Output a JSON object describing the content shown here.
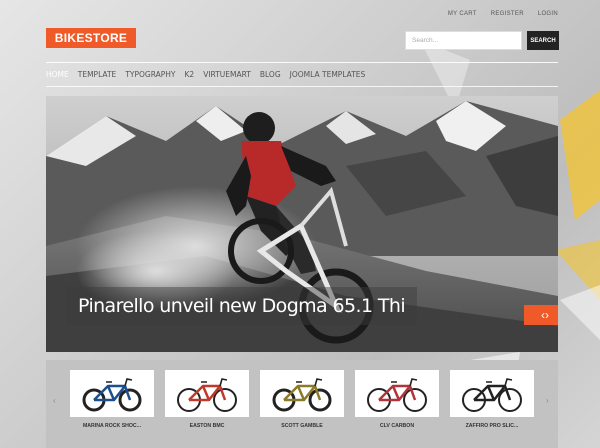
{
  "header": {
    "top_links": [
      "MY CART",
      "REGISTER",
      "LOGIN"
    ],
    "logo_text": "BIKESTORE",
    "search_placeholder": "Search...",
    "search_button": "SEARCH"
  },
  "nav": {
    "items": [
      "HOME",
      "TEMPLATE",
      "TYPOGRAPHY",
      "K2",
      "VIRTUEMART",
      "BLOG",
      "JOOMLA TEMPLATES"
    ],
    "active_index": 0
  },
  "slider": {
    "caption": "Pinarello unveil new Dogma 65.1 Thi",
    "next_icon": "chevron-left-right-icon"
  },
  "carousel": {
    "prev_icon": "chevron-left-icon",
    "next_icon": "chevron-right-icon",
    "products": [
      {
        "name": "MARINA ROCK SHOC...",
        "icon": "mountain-bike-icon",
        "frame_color": "#1c4f8c"
      },
      {
        "name": "EASTON BMC",
        "icon": "road-bike-icon",
        "frame_color": "#c0392b"
      },
      {
        "name": "SCOTT GAMBLE",
        "icon": "mountain-bike-icon",
        "frame_color": "#8a7a2a"
      },
      {
        "name": "CLV CARBON",
        "icon": "road-bike-icon",
        "frame_color": "#b0343a"
      },
      {
        "name": "ZAFFIRO PRO SLIC...",
        "icon": "road-bike-icon",
        "frame_color": "#222222"
      }
    ]
  },
  "colors": {
    "accent": "#f05a28",
    "background": "#c9c9c9"
  }
}
